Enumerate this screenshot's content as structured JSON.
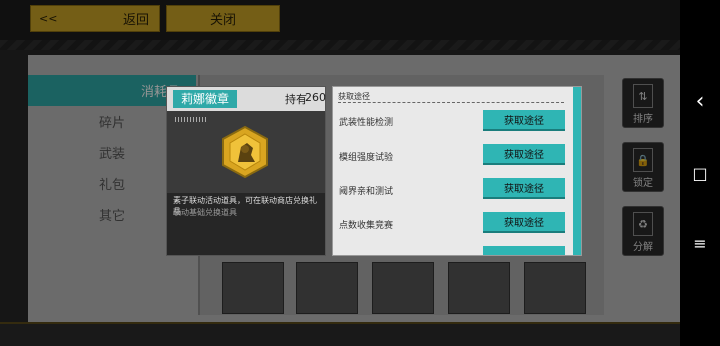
{
  "topbar": {
    "back_arrows": "<<",
    "back_label": "返回",
    "close_label": "关闭"
  },
  "categories": [
    {
      "label": "消耗品",
      "active": true
    },
    {
      "label": "碎片",
      "active": false
    },
    {
      "label": "武装",
      "active": false
    },
    {
      "label": "礼包",
      "active": false
    },
    {
      "label": "其它",
      "active": false
    }
  ],
  "side_buttons": [
    {
      "label": "排序",
      "icon": "sort-icon"
    },
    {
      "label": "锁定",
      "icon": "lock-icon"
    },
    {
      "label": "分解",
      "icon": "recycle-icon"
    }
  ],
  "item": {
    "name": "莉娜徽章",
    "hold_label": "持有",
    "hold_count": "260",
    "description": "素子联动活动道具，可在联动商店兑换礼品",
    "subdescription": "联动基础兑换道具"
  },
  "sources": {
    "title": "获取途径",
    "entries": [
      {
        "name": "武装性能检测",
        "button": "获取途径"
      },
      {
        "name": "模组强度试验",
        "button": "获取途径"
      },
      {
        "name": "阈界亲和测试",
        "button": "获取途径"
      },
      {
        "name": "点数收集竞赛",
        "button": "获取途径"
      }
    ]
  },
  "colors": {
    "accent": "#2fa9a8",
    "gold": "#c9a227"
  },
  "system_nav": {
    "back": "‹",
    "home": "□",
    "menu": "≡"
  }
}
